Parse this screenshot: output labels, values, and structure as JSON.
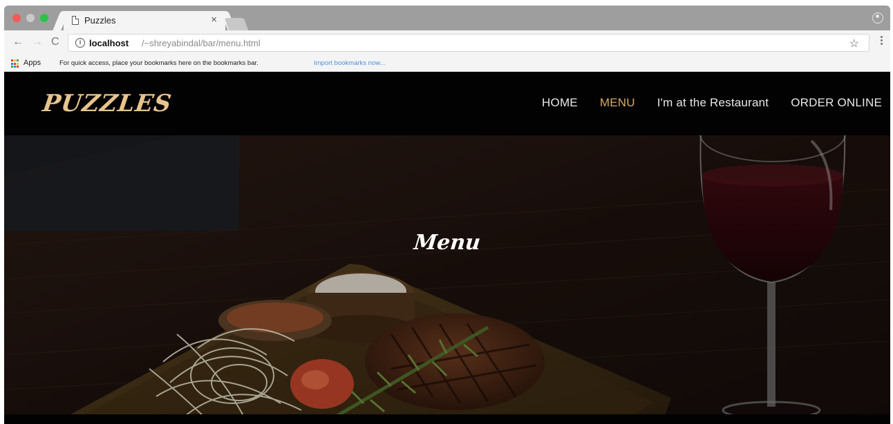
{
  "browser": {
    "tab_title": "Puzzles",
    "tab_close": "×",
    "nav_back": "←",
    "nav_forward": "→",
    "nav_reload": "C",
    "info": "i",
    "url_host": "localhost",
    "url_path": "/~shreyabindal/bar/menu.html",
    "star": "☆",
    "apps_label": "Apps",
    "bookmark_hint": "For quick access, place your bookmarks here on the bookmarks bar.",
    "import_link": "Import bookmarks now...",
    "colors": {
      "tab_bg": "#f4f4f4",
      "strip_bg": "#9e9e9e",
      "link": "#4f8fd9"
    }
  },
  "site": {
    "brand": "PUZZLES",
    "nav": {
      "home": "HOME",
      "menu": "MENU",
      "restaurant": "I'm at the Restaurant",
      "order": "ORDER ONLINE"
    },
    "active_nav": "MENU",
    "hero_title": "Menu",
    "colors": {
      "brand": "#e7c48d",
      "active": "#d6ab67",
      "header_bg": "#020202"
    }
  }
}
